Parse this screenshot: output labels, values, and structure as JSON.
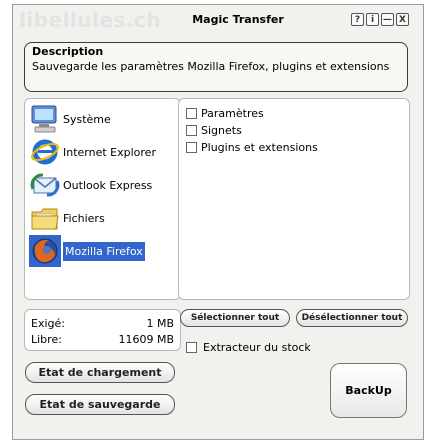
{
  "window": {
    "watermark": "libellules.ch",
    "title": "Magic Transfer",
    "buttons": [
      "?",
      "i",
      "—",
      "X"
    ]
  },
  "description": {
    "title": "Description",
    "text": "Sauvegarde les paramètres Mozilla Firefox, plugins et extensions"
  },
  "sources": [
    {
      "label": "Système",
      "icon": "computer-icon"
    },
    {
      "label": "Internet Explorer",
      "icon": "internet-explorer-icon"
    },
    {
      "label": "Outlook Express",
      "icon": "outlook-express-icon"
    },
    {
      "label": "Fichiers",
      "icon": "folder-icon"
    },
    {
      "label": "Mozilla Firefox",
      "icon": "firefox-icon",
      "selected": true
    }
  ],
  "options": [
    {
      "label": "Paramètres",
      "checked": false
    },
    {
      "label": "Signets",
      "checked": false
    },
    {
      "label": "Plugins et extensions",
      "checked": false
    }
  ],
  "stats": {
    "required_label": "Exigé:",
    "required_value": "1 MB",
    "free_label": "Libre:",
    "free_value": "11609 MB"
  },
  "buttons": {
    "select_all": "Sélectionner tout",
    "deselect_all": "Désélectionner tout",
    "load_state": "Etat de chargement",
    "save_state": "Etat de sauvegarde",
    "backup": "BackUp"
  },
  "stock_extractor": {
    "label": "Extracteur du stock",
    "checked": false
  }
}
